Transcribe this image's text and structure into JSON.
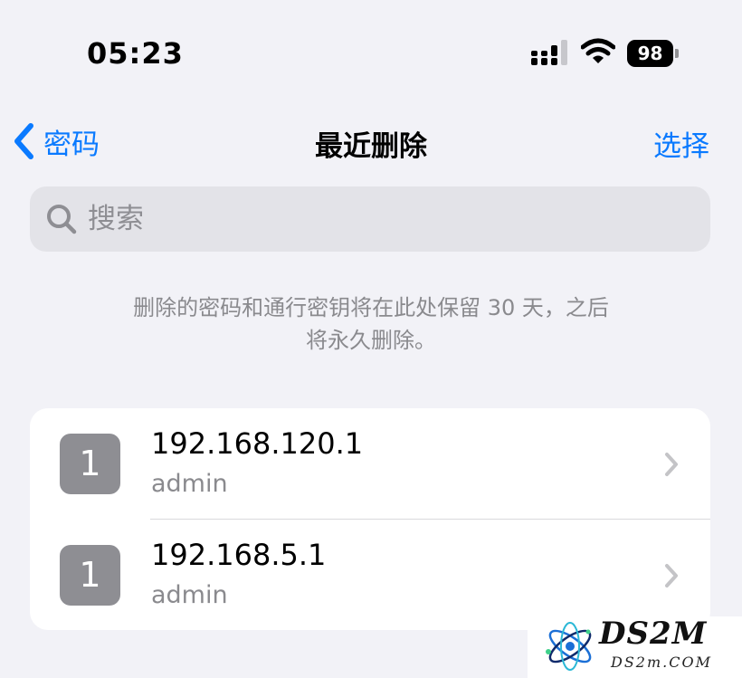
{
  "status_bar": {
    "time": "05:23",
    "battery": "98",
    "signal_icon": "cellular-signal-icon",
    "wifi_icon": "wifi-icon"
  },
  "nav": {
    "back_label": "密码",
    "title": "最近删除",
    "select_label": "选择"
  },
  "search": {
    "placeholder": "搜索"
  },
  "info": {
    "line1": "删除的密码和通行密钥将在此处保留 30 天，之后",
    "line2": "将永久删除。"
  },
  "entries": [
    {
      "icon_letter": "1",
      "site": "192.168.120.1",
      "username": "admin"
    },
    {
      "icon_letter": "1",
      "site": "192.168.5.1",
      "username": "admin"
    }
  ],
  "watermark": {
    "brand": "DS2M",
    "domain": "DS2m.COM"
  },
  "colors": {
    "accent": "#0a7aff",
    "background": "#f2f2f7",
    "secondary_text": "#8a8a8e",
    "favicon": "#8e8e93"
  }
}
